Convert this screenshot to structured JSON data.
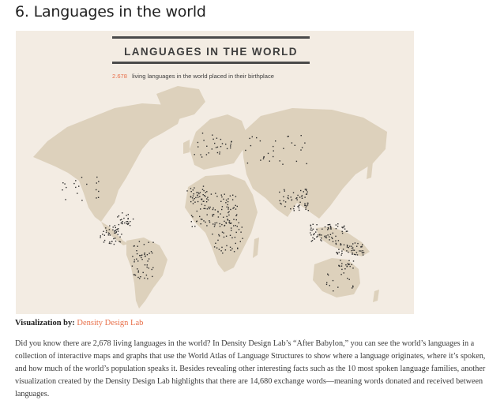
{
  "heading": "6. Languages in the world",
  "figure": {
    "title": "LANGUAGES IN THE WORLD",
    "count": "2.678",
    "subtitle": "living languages in the world placed in their birthplace",
    "colors": {
      "background": "#f3ece3",
      "land": "#ddd1bc",
      "dots": "#2d2d2d",
      "accent": "#e8704a",
      "rule": "#4a4a4a"
    }
  },
  "credit": {
    "label": "Visualization by:",
    "link_text": "Density Design Lab"
  },
  "paragraph": "Did you know there are 2,678 living languages in the world? In Density Design Lab’s “After Babylon,” you can see the world’s languages in a collection of interactive maps and graphs that use the World Atlas of Language Structures to show where a language originates, where it’s spoken, and how much of the world’s population speaks it. Besides revealing other interesting facts such as the 10 most spoken language families, another visualization created by the Density Design Lab highlights that there are 14,680 exchange words—meaning words donated and received between languages."
}
